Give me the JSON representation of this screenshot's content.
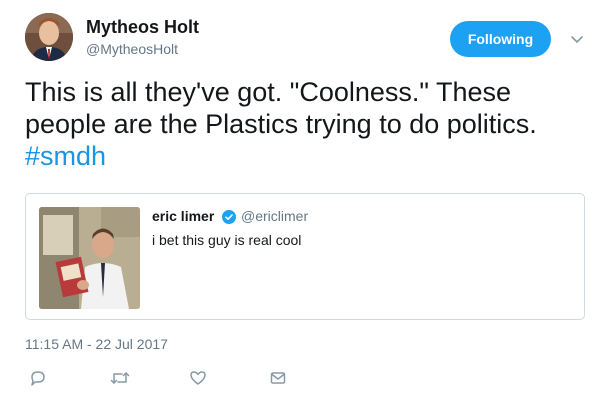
{
  "author": {
    "display_name": "Mytheos Holt",
    "handle": "@MytheosHolt",
    "follow_label": "Following"
  },
  "tweet": {
    "text_line1": "This is all they've got. \"Coolness.\" These",
    "text_line2": "people are the Plastics trying to do politics.",
    "hashtag": "#smdh",
    "timestamp": "11:15 AM - 22 Jul 2017"
  },
  "quoted": {
    "display_name": "eric limer",
    "handle": "@ericlimer",
    "text": "i bet this guy is real cool"
  },
  "icons": {
    "caret": "chevron-down-icon",
    "verified": "verified-badge-icon",
    "reply": "reply-icon",
    "retweet": "retweet-icon",
    "like": "heart-icon",
    "dm": "envelope-icon"
  },
  "colors": {
    "accent": "#1da1f2",
    "hashtag": "#1b95e0",
    "secondary_text": "#657786",
    "icon_gray": "#8899a6"
  }
}
